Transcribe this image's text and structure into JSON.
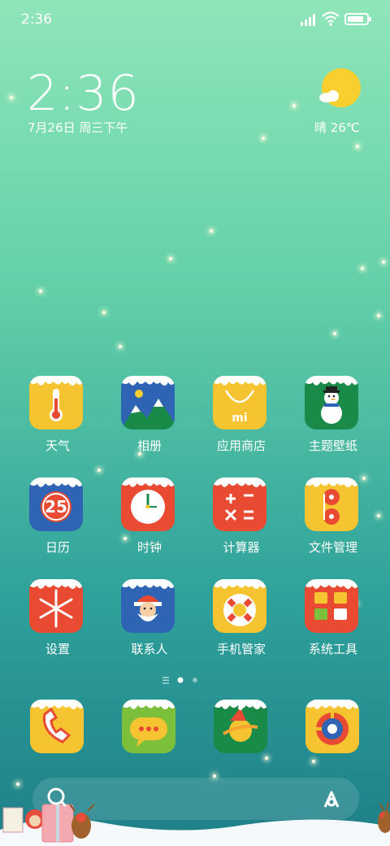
{
  "status_bar": {
    "time": "2:36",
    "battery_level": 0.9
  },
  "lockclock": {
    "time": "2:36",
    "date": "7月26日 周三下午"
  },
  "weather": {
    "text": "晴 26℃",
    "icon": "sun-cloud-icon"
  },
  "apps": [
    {
      "label": "天气",
      "icon": "thermometer-icon",
      "color": "#f7c431"
    },
    {
      "label": "相册",
      "icon": "mountain-icon",
      "color": "#2f64b5"
    },
    {
      "label": "应用商店",
      "icon": "shopping-bag-icon",
      "color": "#f7c431"
    },
    {
      "label": "主题壁纸",
      "icon": "snowman-icon",
      "color": "#1a8a49"
    },
    {
      "label": "日历",
      "icon": "calendar-icon",
      "color": "#2f64b5"
    },
    {
      "label": "时钟",
      "icon": "clock-icon",
      "color": "#e84a32"
    },
    {
      "label": "计算器",
      "icon": "calculator-icon",
      "color": "#e84a32"
    },
    {
      "label": "文件管理",
      "icon": "film-reel-icon",
      "color": "#f7c431"
    },
    {
      "label": "设置",
      "icon": "snowflake-icon",
      "color": "#e84a32"
    },
    {
      "label": "联系人",
      "icon": "santa-icon",
      "color": "#2f64b5"
    },
    {
      "label": "手机管家",
      "icon": "lifebuoy-icon",
      "color": "#f7c431"
    },
    {
      "label": "系统工具",
      "icon": "folder-icon",
      "color": "#e84a32"
    }
  ],
  "calendar_day": "25",
  "store_logo": "mi",
  "dock": [
    {
      "icon": "phone-icon",
      "color": "#f7c431"
    },
    {
      "icon": "message-icon",
      "color": "#7cbf3a"
    },
    {
      "icon": "browser-planet-icon",
      "color": "#1a8a49"
    },
    {
      "icon": "camera-icon",
      "color": "#f7c431"
    }
  ],
  "page_indicator": {
    "pages": 2,
    "current": 1
  }
}
